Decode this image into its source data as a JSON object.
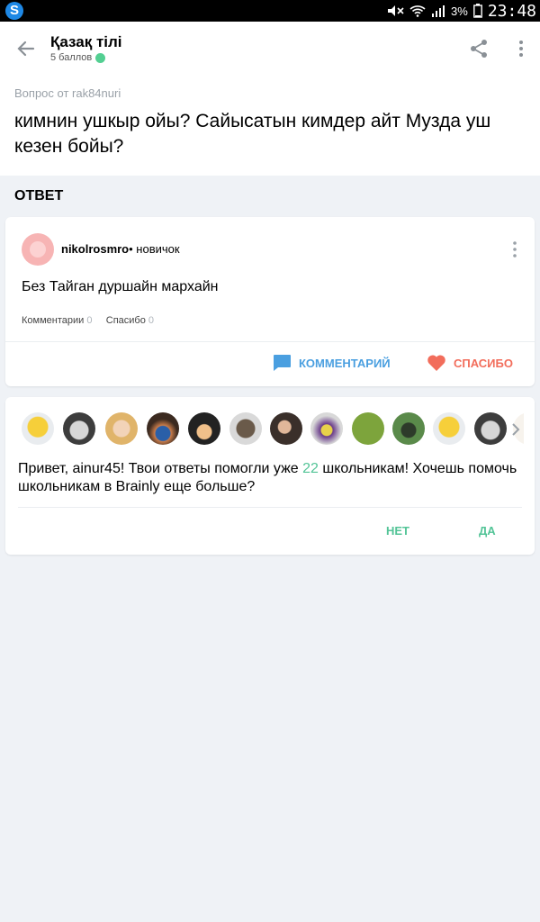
{
  "status_bar": {
    "battery_percent": "3%",
    "time": "23:48"
  },
  "header": {
    "subject": "Қазақ тілі",
    "points": "5 баллов"
  },
  "question": {
    "from_label": "Вопрос от rak84nuri",
    "text": "кимнин ушкыр ойы? Сайысатын кимдер айт Музда уш кезен бойы?"
  },
  "answer_section": {
    "heading": "ОТВЕТ"
  },
  "answer": {
    "author": "nikolrosmro",
    "rank": "• новичок",
    "text": "Без Тайган дуршайн мархайн",
    "comments_label": "Комментарии",
    "comments_count": "0",
    "thanks_label": "Спасибо",
    "thanks_count": "0",
    "comment_button": "КОММЕНТАРИЙ",
    "thanks_button": "СПАСИБО"
  },
  "promo": {
    "text_before": "Привет, ainur45! Твои ответы помогли уже ",
    "count": "22",
    "text_after": " школьникам! Хочешь помочь школьникам в Brainly еще больше?",
    "no_button": "НЕТ",
    "yes_button": "ДА"
  },
  "colors": {
    "accent_green": "#53c497",
    "comment_blue": "#4a9fe0",
    "thanks_red": "#f26d5b"
  }
}
